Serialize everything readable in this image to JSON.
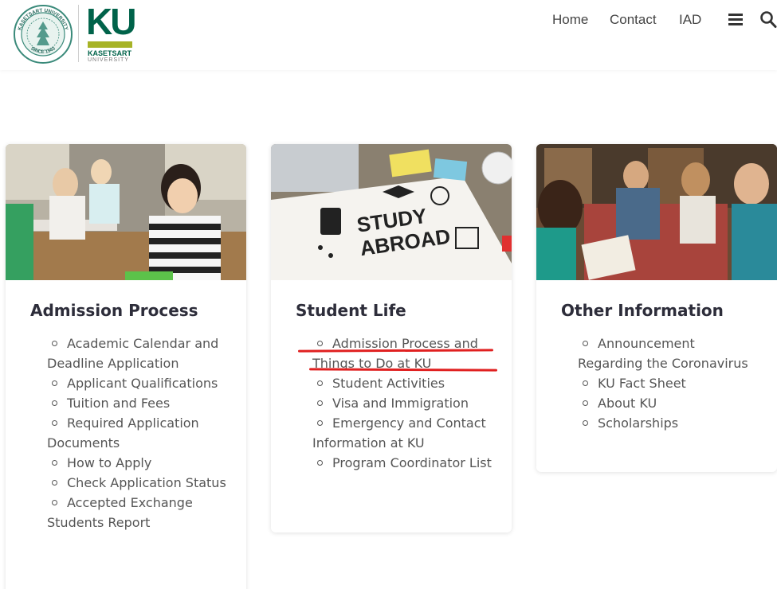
{
  "header": {
    "seal_text_top": "KASETSART UNIVERSITY",
    "seal_text_bottom": "SINCE 1943",
    "logo_letters": "KU",
    "logo_name": "KASETSART",
    "logo_sub": "UNIVERSITY",
    "nav": [
      {
        "label": "Home"
      },
      {
        "label": "Contact"
      },
      {
        "label": "IAD"
      }
    ],
    "menu_icon": "hamburger-menu-icon",
    "search_icon": "search-icon"
  },
  "colors": {
    "brand_green": "#00634a",
    "brand_lime": "#a7b326",
    "annotation_red": "#e02020"
  },
  "cards": [
    {
      "title": "Admission Process",
      "image": "students-smiling-classroom-photo",
      "items": [
        "Academic Calendar and Deadline Application",
        "Applicant Qualifications",
        "Tuition and Fees",
        "Required Application Documents",
        "How to Apply",
        "Check Application Status",
        "Accepted Exchange Students Report"
      ]
    },
    {
      "title": "Student Life",
      "image": "study-abroad-notebook-photo",
      "image_text_1": "STUDY",
      "image_text_2": "ABROAD",
      "items": [
        "Admission Process and Things to Do at KU",
        "Student Activities",
        "Visa and Immigration",
        "Emergency and Contact Information at KU",
        "Program Coordinator List"
      ]
    },
    {
      "title": "Other Information",
      "image": "students-group-library-photo",
      "items": [
        "Announcement Regarding the Coronavirus",
        "KU Fact Sheet",
        "About KU",
        "Scholarships"
      ]
    }
  ]
}
